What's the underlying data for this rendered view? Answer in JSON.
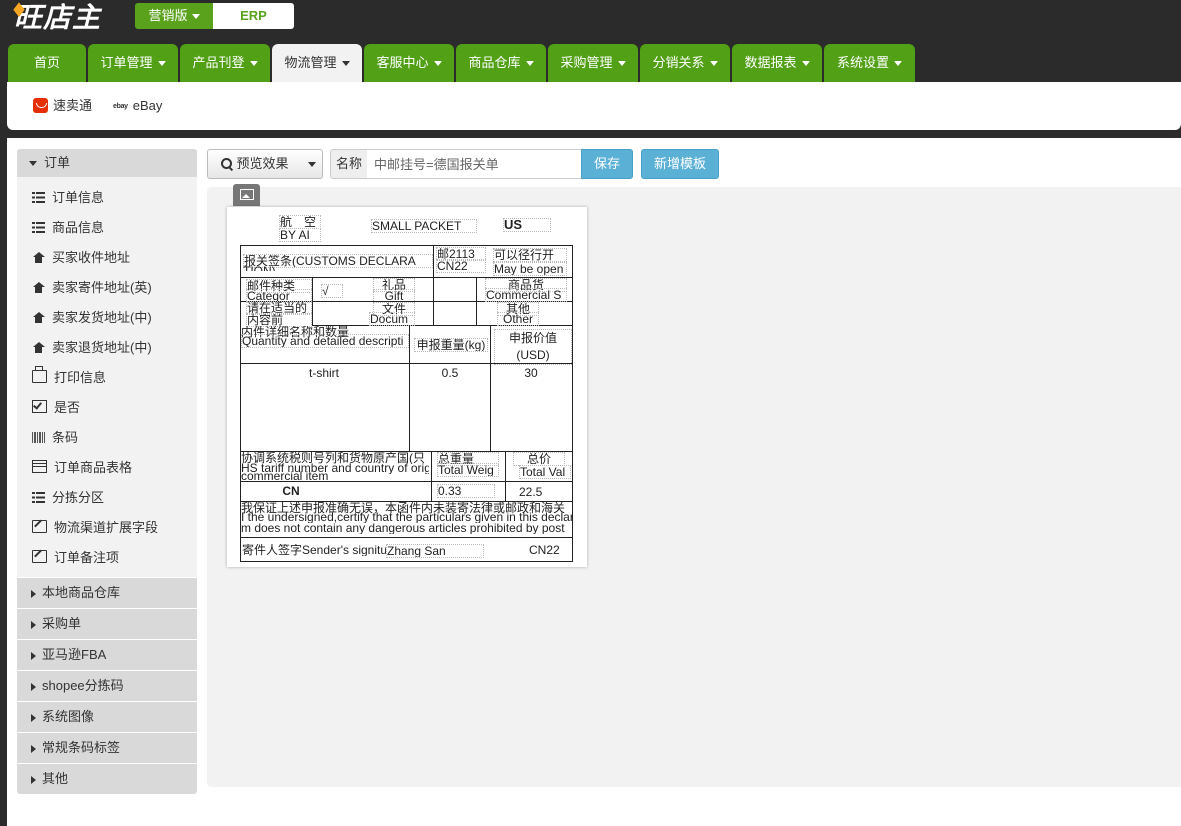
{
  "brand": {
    "logo_text": "旺店主"
  },
  "header": {
    "edition_label": "营销版",
    "erp_label": "ERP"
  },
  "nav": {
    "tabs": [
      {
        "label": "首页"
      },
      {
        "label": "订单管理"
      },
      {
        "label": "产品刊登"
      },
      {
        "label": "物流管理"
      },
      {
        "label": "客服中心"
      },
      {
        "label": "商品仓库"
      },
      {
        "label": "采购管理"
      },
      {
        "label": "分销关系"
      },
      {
        "label": "数据报表"
      },
      {
        "label": "系统设置"
      }
    ]
  },
  "platforms": [
    {
      "label": "速卖通",
      "icon": "aliexpress-icon"
    },
    {
      "label": "eBay",
      "icon": "ebay-icon",
      "logo_text": "ebay"
    }
  ],
  "sidebar": {
    "section_title": "订单",
    "items": [
      {
        "label": "订单信息",
        "icon": "list-icon"
      },
      {
        "label": "商品信息",
        "icon": "list-icon"
      },
      {
        "label": "买家收件地址",
        "icon": "home-icon"
      },
      {
        "label": "卖家寄件地址(英)",
        "icon": "home-icon"
      },
      {
        "label": "卖家发货地址(中)",
        "icon": "home-icon"
      },
      {
        "label": "卖家退货地址(中)",
        "icon": "home-icon"
      },
      {
        "label": "打印信息",
        "icon": "print-icon"
      },
      {
        "label": "是否",
        "icon": "checkbox-icon"
      },
      {
        "label": "条码",
        "icon": "barcode-icon"
      },
      {
        "label": "订单商品表格",
        "icon": "table-icon"
      },
      {
        "label": "分拣分区",
        "icon": "list-icon"
      },
      {
        "label": "物流渠道扩展字段",
        "icon": "edit-icon"
      },
      {
        "label": "订单备注项",
        "icon": "edit-icon"
      }
    ],
    "groups": [
      {
        "label": "本地商品仓库"
      },
      {
        "label": "采购单"
      },
      {
        "label": "亚马逊FBA"
      },
      {
        "label": "shopee分拣码"
      },
      {
        "label": "系统图像"
      },
      {
        "label": "常规条码标签"
      },
      {
        "label": "其他"
      }
    ]
  },
  "toolbar": {
    "preview_label": "预览效果",
    "name_label": "名称",
    "name_placeholder": "中邮挂号=德国报关单",
    "save_label": "保存",
    "add_template_label": "新增模板"
  },
  "label_template": {
    "airmail_cn": "航　空",
    "airmail_en": "BY  AI",
    "small_packet": "SMALL PACKET",
    "country_code": "US",
    "customs_title": "报关签条(CUSTOMS DECLARA",
    "customs_title_wrap": "TION)",
    "postal_code": "邮2113",
    "postal_cn": "CN22",
    "may_open_cn": "可以径行开",
    "may_open_en": "May be open",
    "category_cn": "邮件种类",
    "category_en": "Categor",
    "category_hint": "请在适当的",
    "category_hint2": "内容前",
    "check_mark": "√",
    "gift_cn": "礼品",
    "gift_en": "Gift",
    "commercial_cn": "商品货",
    "commercial_en": "Commercial S",
    "document_cn": "文件",
    "document_en": "Docum",
    "other_cn": "其他",
    "other_en": "Other",
    "contents_cn": "内件详细名称和数量",
    "contents_en": "Quantity and detailed descripti",
    "weight_header": "申报重量(kg)",
    "value_header": "申报价值(USD)",
    "item_name": "t-shirt",
    "item_weight": "0.5",
    "item_value": "30",
    "tariff_cn": "协调系统税则号列和货物原产国(只",
    "tariff_en": "HS tariff number and country of orig",
    "tariff_en2": "commercial item",
    "total_weight_cn": "总重量",
    "total_weight_en": "Total Weig",
    "total_value_cn": "总价",
    "total_value_en": "Total Val",
    "origin": "CN",
    "total_weight": "0.33",
    "total_value": "22.5",
    "declaration_cn": "我保证上述申报准确无误，本函件内未装寄法律或邮政和海关",
    "declaration_en1": "I the undersigned,certify that the particulars given in this declar",
    "declaration_en2": "m does not contain any dangerous articles prohibited by post",
    "signature_label": "寄件人签字Sender's signitu",
    "signature_name": "Zhang San",
    "footer_code": "CN22"
  }
}
